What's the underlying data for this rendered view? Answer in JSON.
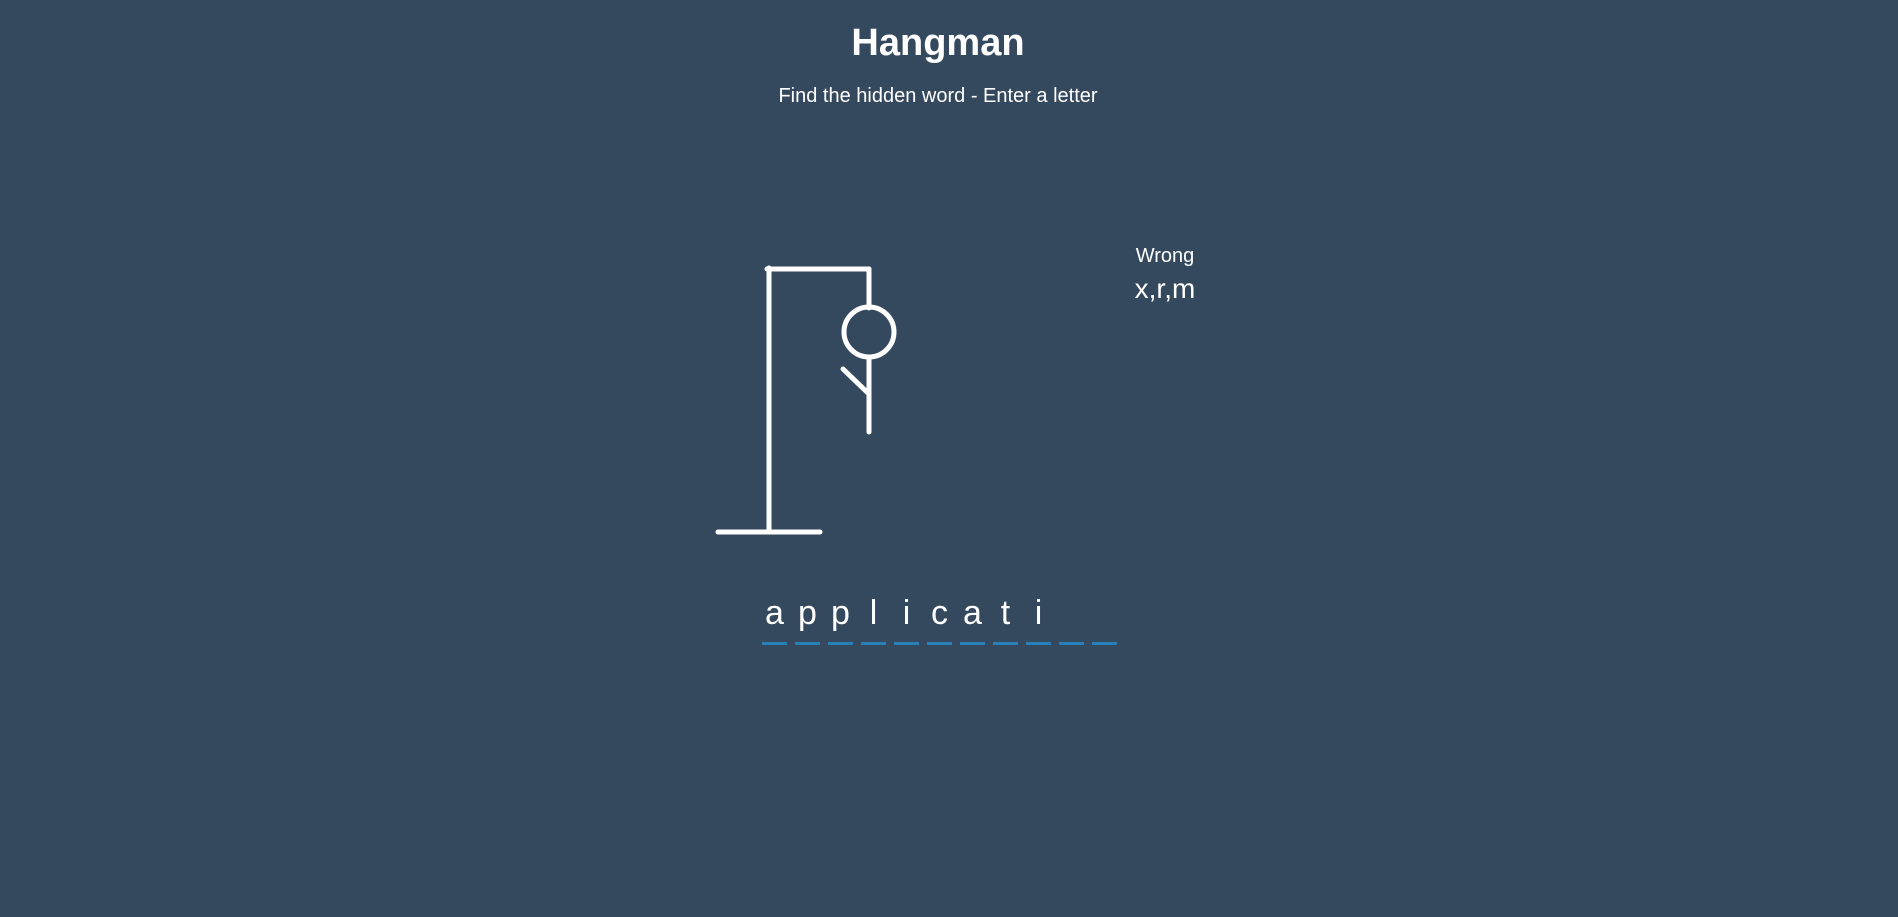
{
  "header": {
    "title": "Hangman",
    "subtitle": "Find the hidden word - Enter a letter"
  },
  "wrong": {
    "label": "Wrong",
    "letters": "x,r,m"
  },
  "word": {
    "slots": [
      "a",
      "p",
      "p",
      "l",
      "i",
      "c",
      "a",
      "t",
      "i",
      "",
      ""
    ]
  },
  "hangman": {
    "parts_shown": [
      "head",
      "body",
      "left-arm"
    ],
    "stroke_color": "#ffffff"
  },
  "colors": {
    "background": "#34495e",
    "underline": "#2980b9",
    "text": "#ffffff"
  }
}
